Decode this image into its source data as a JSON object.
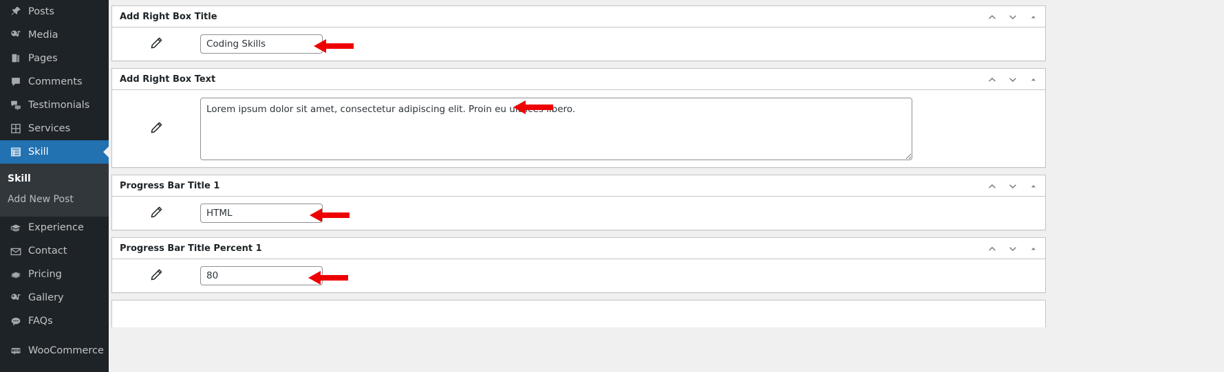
{
  "sidebar": {
    "items": [
      {
        "label": "Posts",
        "icon": "pin-icon",
        "name": "sidebar-item-posts",
        "active": false
      },
      {
        "label": "Media",
        "icon": "media-icon",
        "name": "sidebar-item-media",
        "active": false
      },
      {
        "label": "Pages",
        "icon": "pages-icon",
        "name": "sidebar-item-pages",
        "active": false
      },
      {
        "label": "Comments",
        "icon": "comment-icon",
        "name": "sidebar-item-comments",
        "active": false
      },
      {
        "label": "Testimonials",
        "icon": "testimonial-icon",
        "name": "sidebar-item-testimonials",
        "active": false
      },
      {
        "label": "Services",
        "icon": "grid-icon",
        "name": "sidebar-item-services",
        "active": false
      },
      {
        "label": "Skill",
        "icon": "list-icon",
        "name": "sidebar-item-skill",
        "active": true
      }
    ],
    "submenu": [
      {
        "label": "Skill",
        "name": "submenu-item-skill",
        "current": true
      },
      {
        "label": "Add New Post",
        "name": "submenu-item-add-new-post",
        "current": false
      }
    ],
    "items_after": [
      {
        "label": "Experience",
        "icon": "graduation-icon",
        "name": "sidebar-item-experience",
        "active": false
      },
      {
        "label": "Contact",
        "icon": "envelope-icon",
        "name": "sidebar-item-contact",
        "active": false
      },
      {
        "label": "Pricing",
        "icon": "money-icon",
        "name": "sidebar-item-pricing",
        "active": false
      },
      {
        "label": "Gallery",
        "icon": "media-icon",
        "name": "sidebar-item-gallery",
        "active": false
      },
      {
        "label": "FAQs",
        "icon": "chat-icon",
        "name": "sidebar-item-faqs",
        "active": false
      }
    ],
    "items_last": [
      {
        "label": "WooCommerce",
        "icon": "woo-icon",
        "name": "sidebar-item-woocommerce",
        "active": false
      }
    ],
    "colors": {
      "background": "#1d2327",
      "submenu_background": "#32373c",
      "active": "#2271b1",
      "text": "#c3c4c7",
      "text_active": "#ffffff"
    }
  },
  "metaboxes": [
    {
      "title": "Add Right Box Title",
      "field_type": "text",
      "value": "Coding Skills",
      "placeholder": "",
      "name": "metabox-add-right-box-title",
      "input_name": "right-box-title-input",
      "arrow": true
    },
    {
      "title": "Add Right Box Text",
      "field_type": "textarea",
      "value": "Lorem ipsum dolor sit amet, consectetur adipiscing elit. Proin eu ultrices libero.",
      "placeholder": "",
      "name": "metabox-add-right-box-text",
      "input_name": "right-box-text-textarea",
      "arrow": true
    },
    {
      "title": "Progress Bar Title 1",
      "field_type": "text",
      "value": "HTML",
      "placeholder": "",
      "name": "metabox-progress-bar-title-1",
      "input_name": "progress-bar-title-1-input",
      "arrow": true
    },
    {
      "title": "Progress Bar Title Percent 1",
      "field_type": "text",
      "value": "80",
      "placeholder": "",
      "name": "metabox-progress-bar-title-percent-1",
      "input_name": "progress-bar-title-percent-1-input",
      "arrow": true
    }
  ],
  "handle_actions": {
    "move_up_label": "Move up",
    "move_down_label": "Move down",
    "toggle_label": "Toggle panel",
    "icons": [
      "chevron-up-icon",
      "chevron-down-icon",
      "triangle-up-icon"
    ]
  },
  "annotation": {
    "color": "#ee0000",
    "count": 4,
    "direction": "left"
  }
}
